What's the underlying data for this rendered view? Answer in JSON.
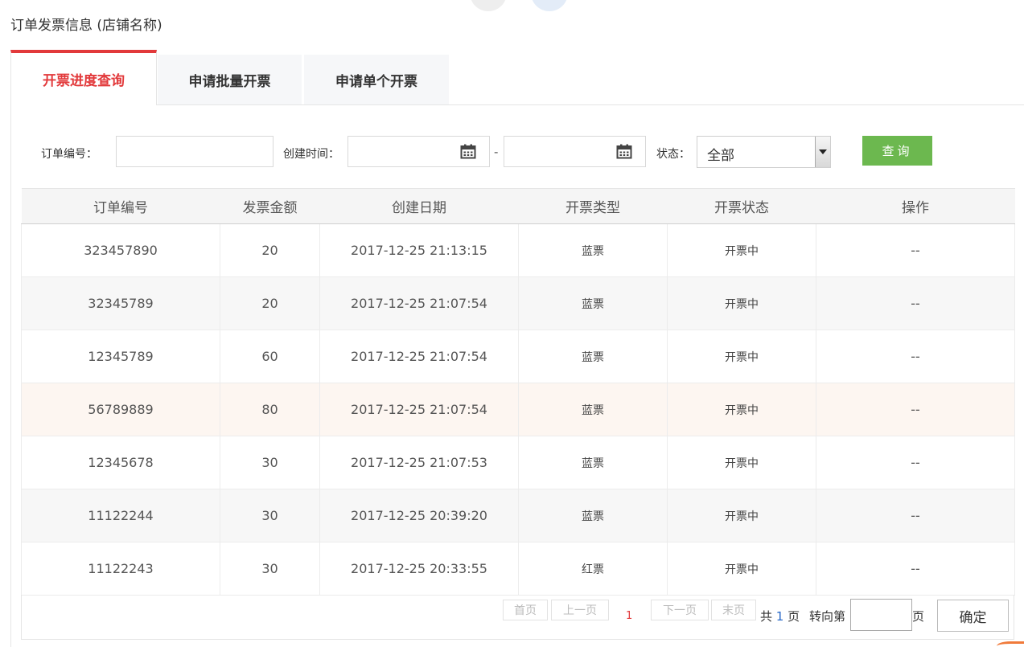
{
  "page": {
    "title": "订单发票信息 (店铺名称)"
  },
  "tabs": [
    {
      "label": "开票进度查询",
      "active": true
    },
    {
      "label": "申请批量开票",
      "active": false
    },
    {
      "label": "申请单个开票",
      "active": false
    }
  ],
  "search": {
    "order_no_label": "订单编号：",
    "order_no_value": "",
    "created_label": "创建时间：",
    "start_date": "",
    "range_sep": "-",
    "end_date": "",
    "status_label": "状态：",
    "status_selected": "全部",
    "query_label": "查询"
  },
  "table": {
    "headers": [
      "订单编号",
      "发票金额",
      "创建日期",
      "开票类型",
      "开票状态",
      "操作"
    ],
    "rows": [
      [
        "323457890",
        "20",
        "2017-12-25 21:13:15",
        "蓝票",
        "开票中",
        "--"
      ],
      [
        "32345789",
        "20",
        "2017-12-25 21:07:54",
        "蓝票",
        "开票中",
        "--"
      ],
      [
        "12345789",
        "60",
        "2017-12-25 21:07:54",
        "蓝票",
        "开票中",
        "--"
      ],
      [
        "56789889",
        "80",
        "2017-12-25 21:07:54",
        "蓝票",
        "开票中",
        "--"
      ],
      [
        "12345678",
        "30",
        "2017-12-25 21:07:53",
        "蓝票",
        "开票中",
        "--"
      ],
      [
        "11122244",
        "30",
        "2017-12-25 20:39:20",
        "蓝票",
        "开票中",
        "--"
      ],
      [
        "11122243",
        "30",
        "2017-12-25 20:33:55",
        "红票",
        "开票中",
        "--"
      ]
    ]
  },
  "pager": {
    "first": "首页",
    "prev": "上一页",
    "current": "1",
    "next": "下一页",
    "last": "末页",
    "total_prefix": "共",
    "total_pages": "1",
    "total_suffix": "页",
    "goto_label": "转向第",
    "goto_value": "",
    "page_suffix": "页",
    "confirm": "确定"
  },
  "colors": {
    "accent": "#e2393b",
    "query_button": "#6cb84f",
    "page_link": "#2a6ac8"
  },
  "icons": {
    "date_picker": "calendar-icon",
    "select_arrow": "caret-down-icon"
  }
}
